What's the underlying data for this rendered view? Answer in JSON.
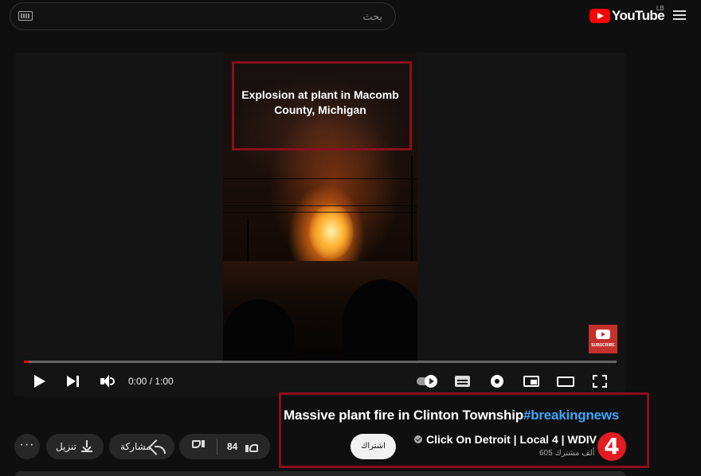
{
  "header": {
    "search_placeholder": "بحث",
    "logo_text": "YouTube",
    "country_code": "LB",
    "icons": [
      "keyboard-icon",
      "youtube-logo-icon",
      "menu-icon"
    ]
  },
  "player": {
    "caption": "Explosion at plant in Macomb County, Michigan",
    "watermark_label": "SUBSCRIBE",
    "time_display": "0:00 / 1:00",
    "progress_fraction": 0.0,
    "accent_color": "#ff0000"
  },
  "video": {
    "title_main": "Massive plant fire in Clinton Township",
    "title_hashtag": "#breakingnews",
    "hashtag_color": "#3ea6ff"
  },
  "channel": {
    "name": "Click On Detroit | Local 4 | WDIV",
    "subscribers": "605 ألف مشترك",
    "logo_text": "4",
    "logo_color": "#e31b23",
    "subscribe_label": "اشتراك"
  },
  "actions": {
    "more_label": "···",
    "download_label": "تنزيل",
    "share_label": "مشاركة",
    "like_count": "84"
  },
  "highlight_color": "#8b0e1e"
}
